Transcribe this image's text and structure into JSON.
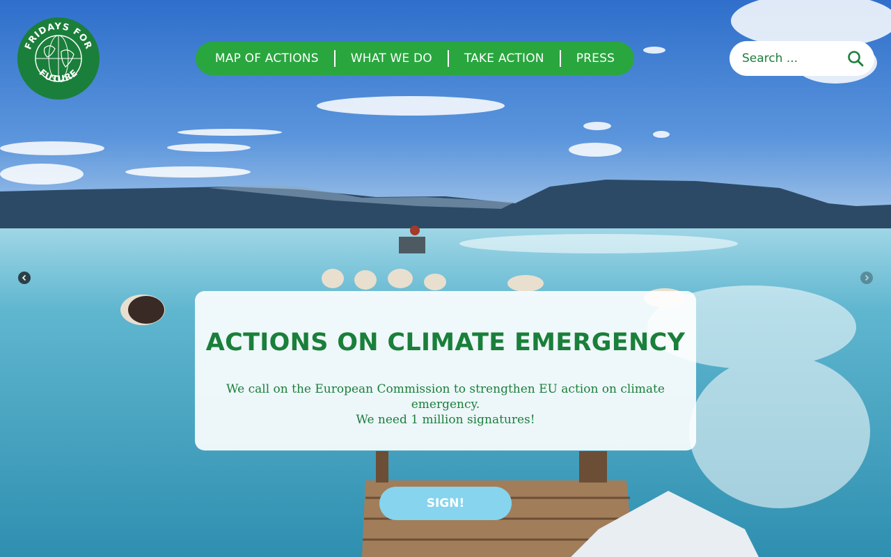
{
  "logo": {
    "line1": "FRIDAYS FOR",
    "line2": "FUTURE",
    "color": "#1a7f3a"
  },
  "nav": {
    "items": [
      {
        "label": "MAP OF ACTIONS"
      },
      {
        "label": "WHAT WE DO"
      },
      {
        "label": "TAKE ACTION"
      },
      {
        "label": "PRESS"
      }
    ],
    "color": "#2aa63f"
  },
  "search": {
    "placeholder": "Search ...",
    "icon": "search-icon"
  },
  "carousel": {
    "prev_icon": "chevron-left-icon",
    "next_icon": "chevron-right-icon"
  },
  "hero": {
    "title": "ACTIONS ON CLIMATE EMERGENCY",
    "description_line1": "We call on the European Commission to strengthen EU action on climate emergency.",
    "description_line2": "We need 1 million signatures!",
    "sign_label": "SIGN!",
    "sign_color": "#86d4ee"
  }
}
